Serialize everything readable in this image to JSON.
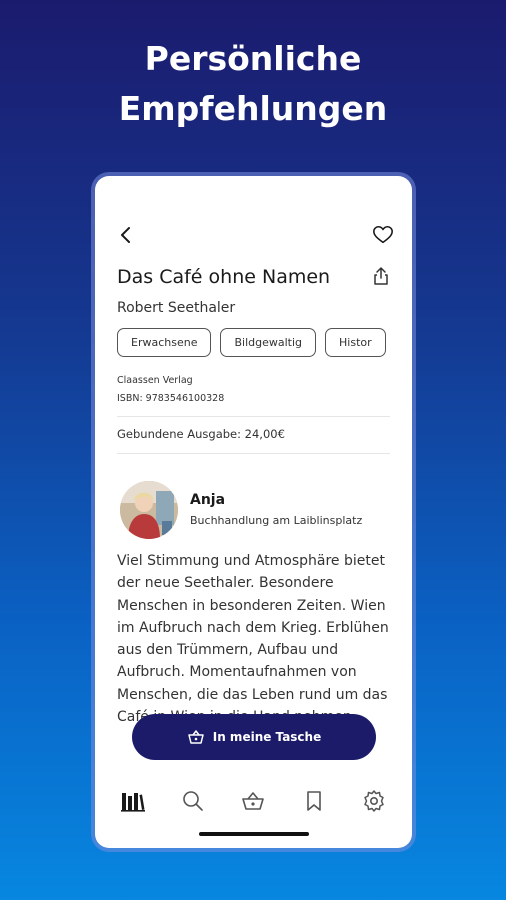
{
  "headline": {
    "line1": "Persönliche",
    "line2": "Empfehlungen"
  },
  "book": {
    "title": "Das Café ohne Namen",
    "author": "Robert Seethaler",
    "tags": [
      "Erwachsene",
      "Bildgewaltig",
      "Histor"
    ],
    "publisher": "Claassen Verlag",
    "isbn": "ISBN: 9783546100328",
    "price": "Gebundene Ausgabe: 24,00€"
  },
  "review": {
    "name": "Anja",
    "shop": "Buchhandlung am Laiblinsplatz",
    "text": "Viel Stimmung und Atmosphäre bietet der neue Seethaler. Besondere Menschen in besonderen Zeiten. Wien im Aufbruch nach dem Krieg. Erblühen aus den Trümmern, Aufbau und Aufbruch. Momentaufnahmen von Menschen, die das Leben rund um das Café in Wien in die Hand nehmen."
  },
  "cart_button": {
    "label": "In meine Tasche"
  },
  "nav": [
    "books-icon",
    "search-icon",
    "basket-icon",
    "bookmark-icon",
    "settings-icon"
  ],
  "colors": {
    "accent": "#1b1b6a",
    "bg_top": "#1b1b6e",
    "bg_bottom": "#0787e0"
  }
}
